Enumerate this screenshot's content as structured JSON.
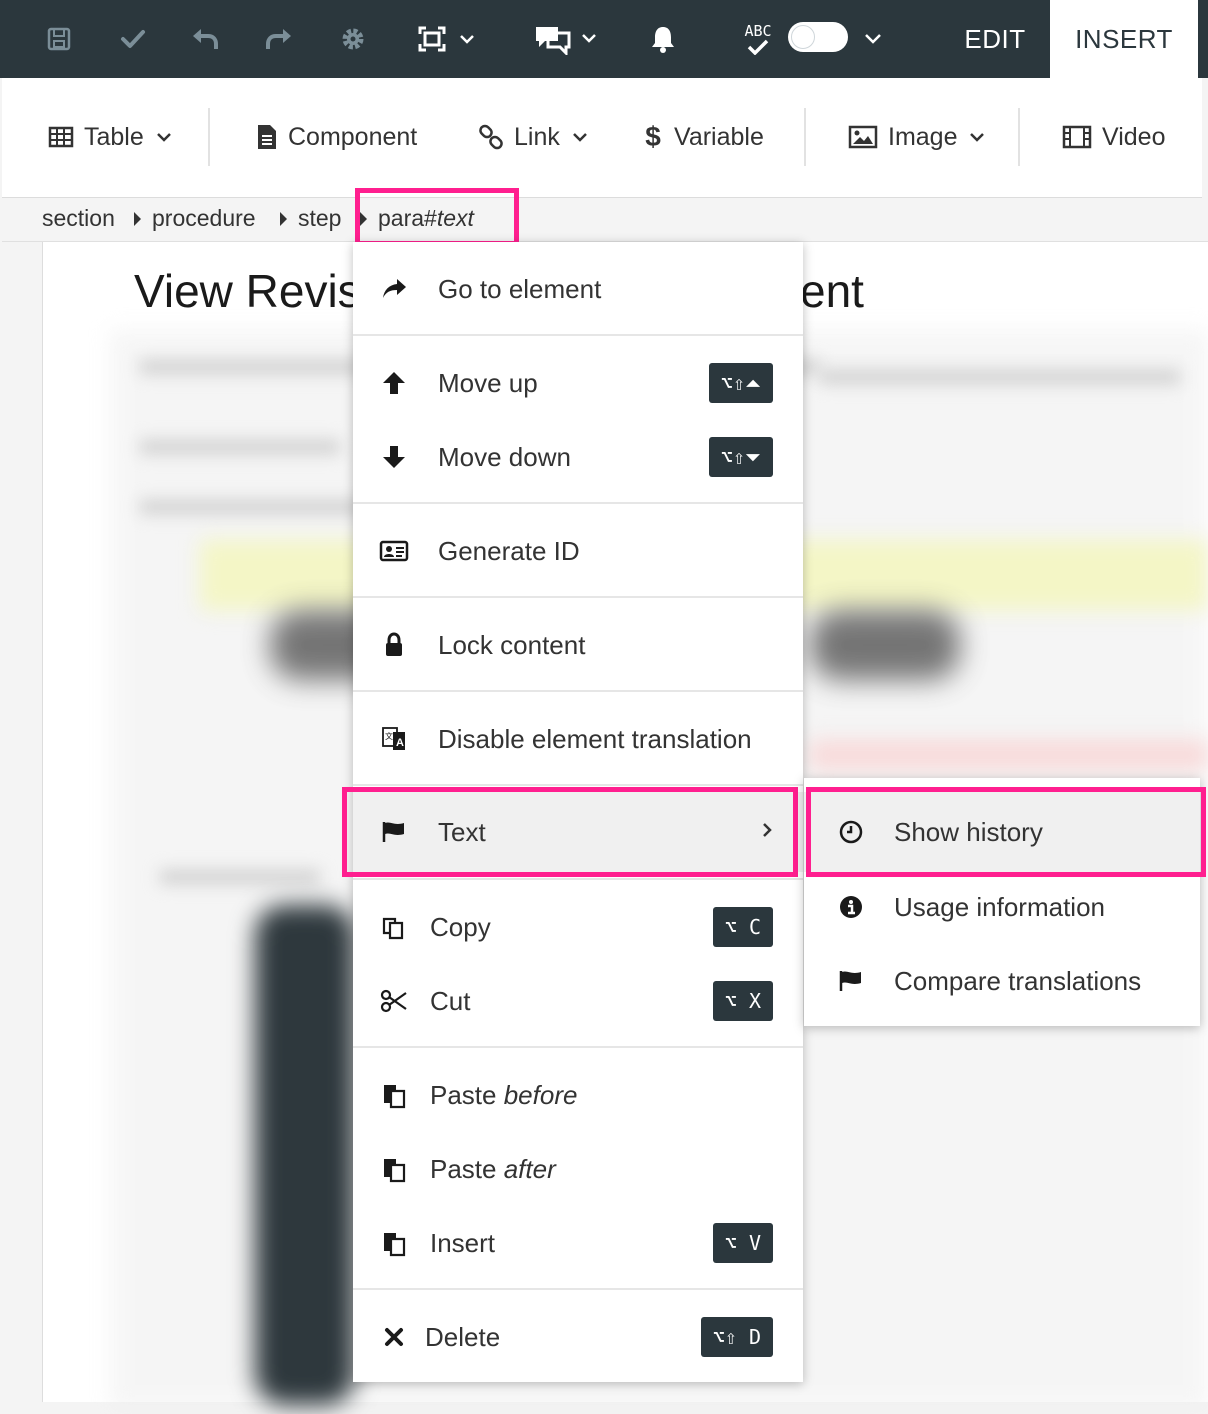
{
  "topbar": {
    "icons": [
      "save-icon",
      "check-icon",
      "undo-icon",
      "redo-icon",
      "settings-icon",
      "fullscreen-icon",
      "comments-icon",
      "bell-icon",
      "spellcheck-icon"
    ],
    "spellcheck_label": "ABC",
    "tabs": {
      "edit": "EDIT",
      "insert": "INSERT"
    }
  },
  "toolbar": {
    "table": "Table",
    "component": "Component",
    "link": "Link",
    "variable": "Variable",
    "image": "Image",
    "video": "Video"
  },
  "breadcrumb": {
    "items": [
      "section",
      "procedure",
      "step"
    ],
    "current_element": "para#",
    "current_node": "text"
  },
  "document": {
    "title_start": "View Revis",
    "title_end": "ent"
  },
  "context_menu": {
    "go_to_element": "Go to element",
    "move_up": "Move up",
    "move_up_shortcut": "⌥⇧⏶",
    "move_down": "Move down",
    "move_down_shortcut": "⌥⇧⏷",
    "generate_id": "Generate ID",
    "lock_content": "Lock content",
    "disable_translation": "Disable element translation",
    "text": "Text",
    "copy": "Copy",
    "copy_shortcut": "⌥ C",
    "cut": "Cut",
    "cut_shortcut": "⌥ X",
    "paste_before_prefix": "Paste ",
    "paste_before_em": "before",
    "paste_after_prefix": "Paste ",
    "paste_after_em": "after",
    "insert": "Insert",
    "insert_shortcut": "⌥ V",
    "delete": "Delete",
    "delete_shortcut": "⌥⇧ D"
  },
  "submenu": {
    "show_history": "Show history",
    "usage_information": "Usage information",
    "compare_translations": "Compare translations"
  },
  "colors": {
    "topbar_bg": "#2b373d",
    "highlight": "#ff1f8f",
    "icon_muted": "#7b8e98",
    "kbd_bg": "#2b373d"
  }
}
